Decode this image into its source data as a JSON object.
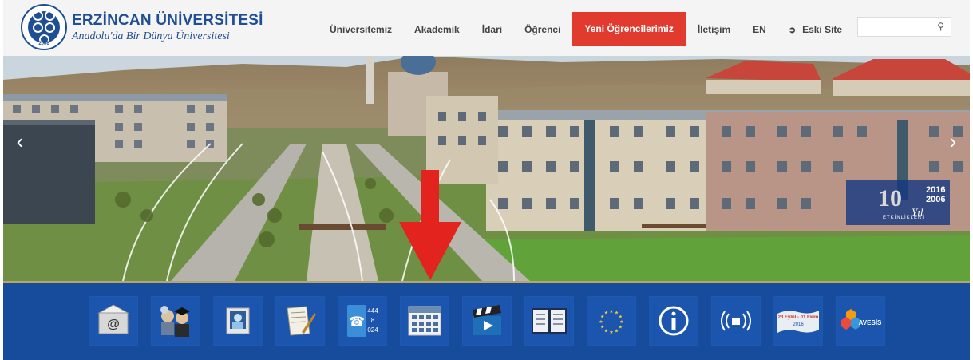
{
  "header": {
    "logo_name": "ERZİNCAN ÜNİVERSİTESİ",
    "logo_slogan": "Anadolu'da Bir Dünya Üniversitesi",
    "seal_text": "ERZİNCAN ÜNİVERSİTESİ",
    "seal_year": "2006"
  },
  "nav": {
    "items": [
      {
        "label": "Üniversitemiz"
      },
      {
        "label": "Akademik"
      },
      {
        "label": "İdari"
      },
      {
        "label": "Öğrenci"
      },
      {
        "label": "Yeni Öğrencilerimiz",
        "active": true
      },
      {
        "label": "İletişim"
      },
      {
        "label": "EN"
      },
      {
        "label": "Eski Site",
        "icon": "external-link-icon"
      }
    ]
  },
  "search": {
    "placeholder": "",
    "icon": "search-icon"
  },
  "hero": {
    "anniversary": {
      "number": "10",
      "years": "2016\n2006",
      "suffix": "Yıl",
      "caption": "ETKİNLİKLERİ"
    },
    "prev_icon": "chevron-left-icon",
    "next_icon": "chevron-right-icon",
    "pointer_icon": "red-down-arrow-icon"
  },
  "quick_links": [
    {
      "icon": "email-icon"
    },
    {
      "icon": "academic-staff-icon"
    },
    {
      "icon": "student-portal-icon"
    },
    {
      "icon": "document-signing-icon"
    },
    {
      "icon": "phone-directory-icon",
      "text": "444 8 024"
    },
    {
      "icon": "calendar-icon"
    },
    {
      "icon": "video-clapper-icon"
    },
    {
      "icon": "book-icon"
    },
    {
      "icon": "eu-stars-icon"
    },
    {
      "icon": "info-icon"
    },
    {
      "icon": "wireless-icon"
    },
    {
      "icon": "event-banner-icon",
      "text": "23 Eylül - 01 Ekim 2016"
    },
    {
      "icon": "avesis-icon",
      "text": "AVESİS"
    }
  ],
  "colors": {
    "brand_blue": "#1f4e94",
    "active_red": "#e13a2f",
    "quickbar_blue": "#174b9c",
    "gold": "#b9a46a"
  }
}
